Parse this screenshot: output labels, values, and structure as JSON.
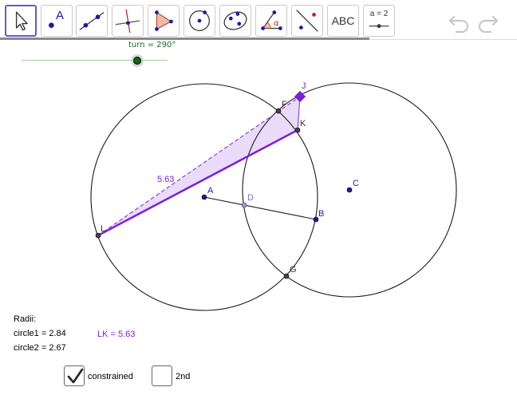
{
  "toolbar": {
    "tools": [
      {
        "name": "move-tool",
        "active": true
      },
      {
        "name": "point-tool",
        "label": "A"
      },
      {
        "name": "line-tool"
      },
      {
        "name": "perpendicular-line-tool"
      },
      {
        "name": "polygon-tool"
      },
      {
        "name": "circle-center-point-tool"
      },
      {
        "name": "ellipse-tool"
      },
      {
        "name": "angle-tool",
        "label": "α"
      },
      {
        "name": "reflect-about-line-tool"
      },
      {
        "name": "text-tool",
        "label": "ABC"
      },
      {
        "name": "slider-tool",
        "label": "a = 2"
      }
    ],
    "undo_icon": "undo-icon",
    "redo_icon": "redo-icon"
  },
  "slider": {
    "caption": "turn = 290°"
  },
  "points": {
    "A": "A",
    "B": "B",
    "C": "C",
    "D": "D",
    "F": "F",
    "G": "G",
    "J": "J",
    "K": "K",
    "L": "L"
  },
  "segment_label": "5.63",
  "info": {
    "heading": "Radii:",
    "circle1": "circle1 = 2.84",
    "circle2": "circle2 = 2.67",
    "lk": "LK = 5.63"
  },
  "checkboxes": [
    {
      "label": "constrained",
      "checked": true
    },
    {
      "label": "2nd",
      "checked": false
    }
  ],
  "colors": {
    "accent": "#6557d2",
    "segment": "#7c1fd8",
    "point_blue": "#1a1aa8",
    "slider_green": "#0e6b0e"
  }
}
